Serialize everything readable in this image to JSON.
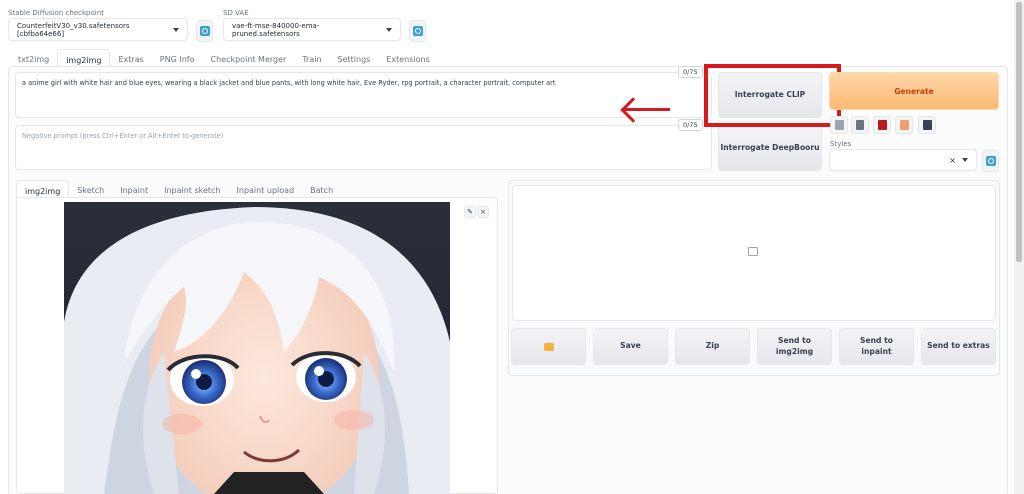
{
  "header": {
    "checkpoint_label": "Stable Diffusion checkpoint",
    "checkpoint_value": "CounterfeitV30_v30.safetensors [cbfba64e66]",
    "vae_label": "SD VAE",
    "vae_value": "vae-ft-mse-840000-ema-pruned.safetensors"
  },
  "main_tabs": [
    "txt2img",
    "img2img",
    "Extras",
    "PNG Info",
    "Checkpoint Merger",
    "Train",
    "Settings",
    "Extensions"
  ],
  "prompt": {
    "value": "a anime girl with white hair and blue eyes, wearing a black jacket and blue pants, with long white hair, Eve Ryder, rpg portrait, a character portrait, computer art",
    "counter": "0/75"
  },
  "negative_prompt": {
    "placeholder": "Negative prompt (press Ctrl+Enter or Alt+Enter to generate)",
    "counter": "0/75"
  },
  "buttons": {
    "interrogate_clip": "Interrogate CLIP",
    "interrogate_deepbooru": "Interrogate DeepBooru",
    "generate": "Generate"
  },
  "styles": {
    "label": "Styles"
  },
  "sub_tabs": [
    "img2img",
    "Sketch",
    "Inpaint",
    "Inpaint sketch",
    "Inpaint upload",
    "Batch"
  ],
  "output_actions": {
    "save": "Save",
    "zip": "Zip",
    "send_img2img": "Send to img2img",
    "send_inpaint": "Send to inpaint",
    "send_extras": "Send to extras"
  },
  "colors": {
    "accent_orange": "#fdba74",
    "annotation_red": "#d71920",
    "refresh_blue": "#3b9fd6"
  },
  "icons": [
    "refresh-icon",
    "paste-icon",
    "trash-icon",
    "book-icon",
    "clipboard-icon",
    "save-icon",
    "folder-icon",
    "image-placeholder-icon",
    "edit-icon",
    "close-icon",
    "clear-icon"
  ]
}
